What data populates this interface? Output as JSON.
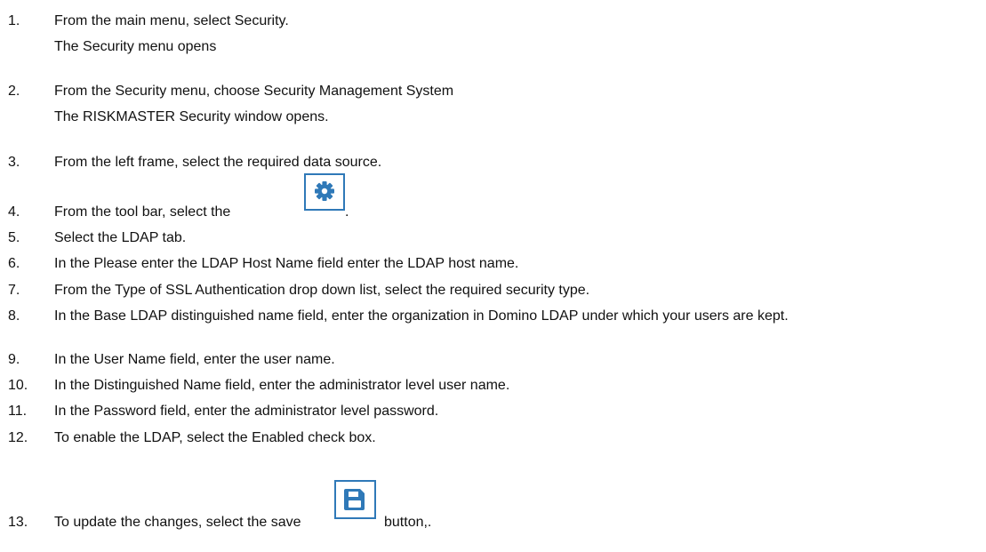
{
  "steps": [
    {
      "num": "1.",
      "text": "From the main menu, select Security.",
      "sub": "The Security menu opens"
    },
    {
      "num": "2.",
      "text": "From the Security menu, choose Security Management System",
      "sub": "The RISKMASTER Security window opens."
    },
    {
      "num": "3.",
      "text": "From the left frame, select the required data source."
    },
    {
      "num": "4.",
      "text": "From the tool bar, select the",
      "tail": ".",
      "icon": "gear-icon"
    },
    {
      "num": "5.",
      "text": "Select the LDAP tab."
    },
    {
      "num": "6.",
      "text": "In the Please enter the LDAP Host Name field enter the LDAP host name."
    },
    {
      "num": "7.",
      "text": "From the Type of SSL Authentication drop down list, select the required security type."
    },
    {
      "num": "8.",
      "text": "In the Base LDAP distinguished name field, enter the organization in Domino LDAP under which your users are kept."
    },
    {
      "num": "9.",
      "text": "In the User Name field, enter the user name."
    },
    {
      "num": "10.",
      "text": "In the Distinguished Name field, enter the administrator level user name."
    },
    {
      "num": "11.",
      "text": "In the Password field, enter the administrator level password."
    },
    {
      "num": "12.",
      "text": "To enable the LDAP, select the  Enabled check box."
    },
    {
      "num": "13.",
      "text": " To update the changes, select the save",
      "tail": "button,.",
      "icon": "save-icon"
    }
  ],
  "colors": {
    "icon_accent": "#2f79b8",
    "text": "#111111"
  }
}
